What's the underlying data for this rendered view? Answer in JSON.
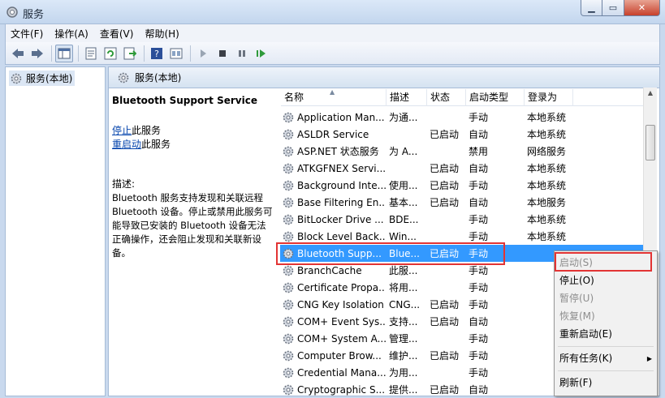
{
  "window": {
    "title": "服务",
    "min": "▁",
    "max": "▭",
    "close": "✕"
  },
  "menu": [
    "文件(F)",
    "操作(A)",
    "查看(V)",
    "帮助(H)"
  ],
  "tree": {
    "root_label": "服务(本地)"
  },
  "header": {
    "title": "服务(本地)"
  },
  "details": {
    "service_name": "Bluetooth Support Service",
    "stop_link": "停止",
    "stop_suffix": "此服务",
    "restart_link": "重启动",
    "restart_suffix": "此服务",
    "desc_label": "描述:",
    "desc_text": "Bluetooth 服务支持发现和关联远程 Bluetooth 设备。停止或禁用此服务可能导致已安装的 Bluetooth 设备无法正确操作，还会阻止发现和关联新设备。"
  },
  "columns": {
    "name": "名称",
    "desc": "描述",
    "status": "状态",
    "start": "启动类型",
    "logon": "登录为"
  },
  "rows": [
    {
      "name": "Application Man...",
      "desc": "为通...",
      "status": "",
      "start": "手动",
      "logon": "本地系统"
    },
    {
      "name": "ASLDR Service",
      "desc": "",
      "status": "已启动",
      "start": "自动",
      "logon": "本地系统"
    },
    {
      "name": "ASP.NET 状态服务",
      "desc": "为 A...",
      "status": "",
      "start": "禁用",
      "logon": "网络服务"
    },
    {
      "name": "ATKGFNEX Servi...",
      "desc": "",
      "status": "已启动",
      "start": "自动",
      "logon": "本地系统"
    },
    {
      "name": "Background Inte...",
      "desc": "使用...",
      "status": "已启动",
      "start": "手动",
      "logon": "本地系统"
    },
    {
      "name": "Base Filtering En...",
      "desc": "基本...",
      "status": "已启动",
      "start": "自动",
      "logon": "本地服务"
    },
    {
      "name": "BitLocker Drive ...",
      "desc": "BDE...",
      "status": "",
      "start": "手动",
      "logon": "本地系统"
    },
    {
      "name": "Block Level Back...",
      "desc": "Win...",
      "status": "",
      "start": "手动",
      "logon": "本地系统"
    },
    {
      "name": "Bluetooth Supp...",
      "desc": "Blue...",
      "status": "已启动",
      "start": "手动",
      "logon": ""
    },
    {
      "name": "BranchCache",
      "desc": "此服...",
      "status": "",
      "start": "手动",
      "logon": ""
    },
    {
      "name": "Certificate Propa...",
      "desc": "将用...",
      "status": "",
      "start": "手动",
      "logon": ""
    },
    {
      "name": "CNG Key Isolation",
      "desc": "CNG...",
      "status": "已启动",
      "start": "手动",
      "logon": ""
    },
    {
      "name": "COM+ Event Sys...",
      "desc": "支持...",
      "status": "已启动",
      "start": "自动",
      "logon": ""
    },
    {
      "name": "COM+ System A...",
      "desc": "管理...",
      "status": "",
      "start": "手动",
      "logon": ""
    },
    {
      "name": "Computer Brow...",
      "desc": "维护...",
      "status": "已启动",
      "start": "手动",
      "logon": ""
    },
    {
      "name": "Credential Mana...",
      "desc": "为用...",
      "status": "",
      "start": "手动",
      "logon": ""
    },
    {
      "name": "Cryptographic S...",
      "desc": "提供...",
      "status": "已启动",
      "start": "自动",
      "logon": ""
    }
  ],
  "context_menu": {
    "start": "启动(S)",
    "stop": "停止(O)",
    "pause": "暂停(U)",
    "resume": "恢复(M)",
    "restart": "重新启动(E)",
    "all_tasks": "所有任务(K)",
    "refresh": "刷新(F)"
  },
  "colors": {
    "selection": "#3399ff",
    "highlight_box": "#e23434"
  },
  "icons": [
    "back-icon",
    "forward-icon",
    "show-tree-icon",
    "properties-icon",
    "refresh-icon",
    "export-icon",
    "help-icon",
    "console-icon",
    "play-icon",
    "stop-icon",
    "pause-icon",
    "resume-icon",
    "gear-icon"
  ]
}
